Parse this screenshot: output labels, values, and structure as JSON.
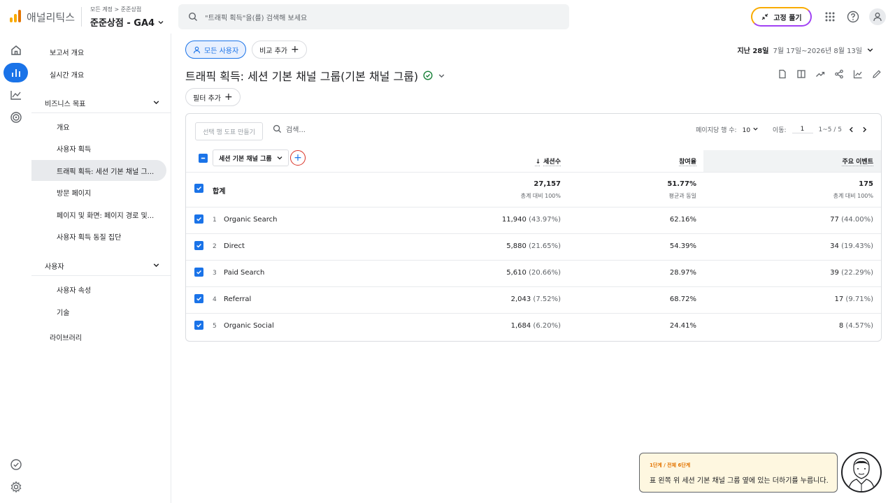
{
  "app": {
    "name": "애널리틱스",
    "breadcrumb_all": "모든 계정",
    "breadcrumb_sep": ">",
    "breadcrumb_account": "준준상점",
    "property": "준준상점 - GA4"
  },
  "search": {
    "placeholder": "\"트래픽 획득\"을(를) 검색해 보세요"
  },
  "header": {
    "pin_button": "고정 풀기"
  },
  "sidebar": {
    "report_overview": "보고서 개요",
    "realtime": "실시간 개요",
    "section_business": "비즈니스 목표",
    "items": [
      "개요",
      "사용자 획득",
      "트래픽 획득: 세션 기본 채널 그...",
      "방문 페이지",
      "페이지 및 화면: 페이지 경로 및...",
      "사용자 획득 동질 집단"
    ],
    "section_user": "사용자",
    "user_items": [
      "사용자 속성",
      "기술"
    ],
    "library": "라이브러리"
  },
  "toolbar": {
    "segment_chip": "모든 사용자",
    "compare_chip": "비교 추가",
    "date_label": "지난 28일",
    "date_range": "7월 17일~2026년 8월 13일",
    "report_title": "트래픽 획득: 세션 기본 채널 그룹(기본 채널 그룹)",
    "filter_chip": "필터 추가"
  },
  "table": {
    "make_row_chart": "선택 행 도표 만들기",
    "search_placeholder": "검색...",
    "rows_per_page_label": "페이지당 행 수:",
    "rows_per_page": "10",
    "goto_label": "이동:",
    "goto_value": "1",
    "range": "1~5 / 5",
    "dimension": "세션 기본 채널 그룹",
    "columns": [
      "세션수",
      "참여율",
      "주요 이벤트"
    ],
    "total": {
      "label": "합계",
      "sessions": "27,157",
      "sessions_sub": "총계 대비 100%",
      "engagement": "51.77%",
      "engagement_sub": "평균과 동일",
      "key_events": "175",
      "key_events_sub": "총계 대비 100%"
    },
    "rows": [
      {
        "idx": "1",
        "name": "Organic Search",
        "sessions": "11,940",
        "sessions_pct": "(43.97%)",
        "engagement": "62.16%",
        "key_events": "77",
        "key_events_pct": "(44.00%)"
      },
      {
        "idx": "2",
        "name": "Direct",
        "sessions": "5,880",
        "sessions_pct": "(21.65%)",
        "engagement": "54.39%",
        "key_events": "34",
        "key_events_pct": "(19.43%)"
      },
      {
        "idx": "3",
        "name": "Paid Search",
        "sessions": "5,610",
        "sessions_pct": "(20.66%)",
        "engagement": "28.97%",
        "key_events": "39",
        "key_events_pct": "(22.29%)"
      },
      {
        "idx": "4",
        "name": "Referral",
        "sessions": "2,043",
        "sessions_pct": "(7.52%)",
        "engagement": "68.72%",
        "key_events": "17",
        "key_events_pct": "(9.71%)"
      },
      {
        "idx": "5",
        "name": "Organic Social",
        "sessions": "1,684",
        "sessions_pct": "(6.20%)",
        "engagement": "24.41%",
        "key_events": "8",
        "key_events_pct": "(4.57%)"
      }
    ]
  },
  "tour": {
    "step": "1단계 / 전체 6단계",
    "message": "표 왼쪽 위 세션 기본 채널 그룹 옆에 있는 더하기를 누릅니다."
  },
  "colors": {
    "accent": "#1a73e8",
    "logo_orange": "#f9ab00",
    "logo_dark": "#e37400",
    "highlight_ring": "#d93025"
  }
}
